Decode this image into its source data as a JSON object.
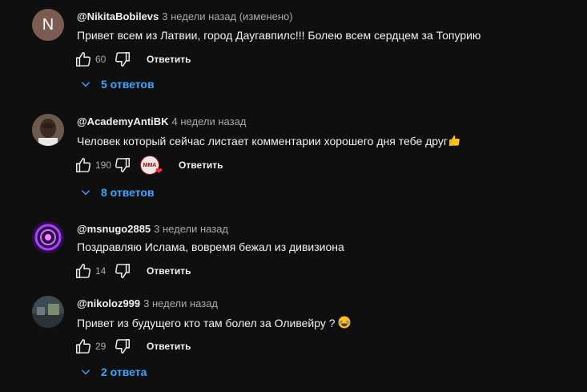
{
  "comments": [
    {
      "avatar_letter": "N",
      "author": "@NikitaBobilevs",
      "time": "3 недели назад (изменено)",
      "text": "Привет всем из Латвии, город Даугавпилс!!! Болею всем сердцем за Топурию",
      "likes": "60",
      "reply_label": "Ответить",
      "replies_label": "5 ответов"
    },
    {
      "author": "@AcademyAntiBK",
      "time": "4 недели назад",
      "text": "Человек который сейчас листает комментарии хорошего дня тебе друг",
      "likes": "190",
      "creator_badge": "MMA",
      "reply_label": "Ответить",
      "replies_label": "8 ответов"
    },
    {
      "author": "@msnugo2885",
      "time": "3 недели назад",
      "text": "Поздравляю Ислама, вовремя бежал из дивизиона",
      "likes": "14",
      "reply_label": "Ответить"
    },
    {
      "author": "@nikoloz999",
      "time": "3 недели назад",
      "text": "Привет из будущего кто там болел за Оливейру ?",
      "likes": "29",
      "reply_label": "Ответить",
      "replies_label": "2 ответа"
    }
  ],
  "icons": {
    "like": "thumb-up-icon",
    "dislike": "thumb-down-icon",
    "replies": "chevron-down-icon",
    "emoji_thumb": "thumbs-up-emoji",
    "emoji_laugh": "laughing-emoji"
  },
  "colors": {
    "background": "#0f0f0f",
    "link": "#3ea6ff",
    "secondary": "#aaaaaa"
  }
}
